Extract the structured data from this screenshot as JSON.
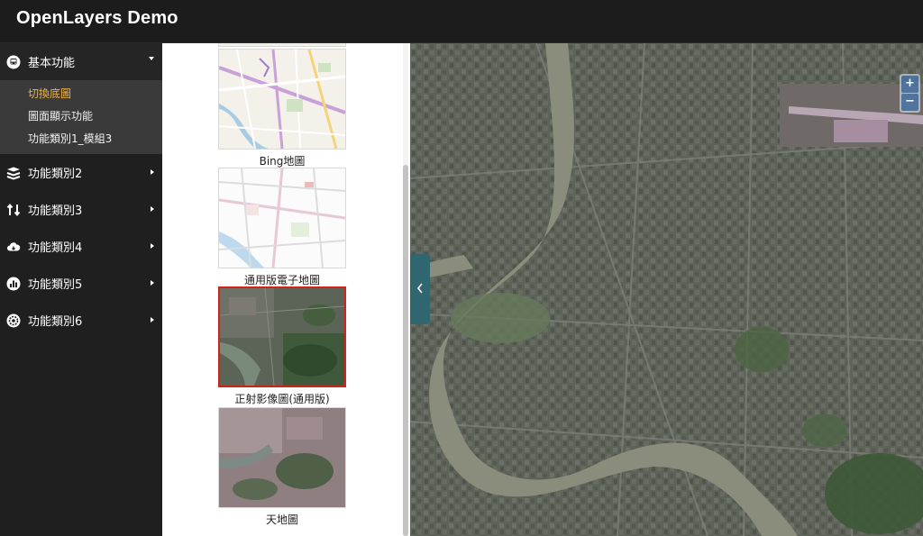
{
  "header": {
    "title": "OpenLayers Demo"
  },
  "sidebar": {
    "items": [
      {
        "label": "基本功能",
        "icon": "bus-icon",
        "expanded": true,
        "children": [
          {
            "label": "切換底圖",
            "active": true
          },
          {
            "label": "圖面顯示功能",
            "active": false
          },
          {
            "label": "功能類別1_模組3",
            "active": false
          }
        ]
      },
      {
        "label": "功能類別2",
        "icon": "layers-icon"
      },
      {
        "label": "功能類別3",
        "icon": "transfer-icon"
      },
      {
        "label": "功能類別4",
        "icon": "cloud-icon"
      },
      {
        "label": "功能類別5",
        "icon": "bar-chart-icon"
      },
      {
        "label": "功能類別6",
        "icon": "settings-icon"
      }
    ]
  },
  "basemaps": [
    {
      "caption": "Bing地圖",
      "selected": false
    },
    {
      "caption": "通用版電子地圖",
      "selected": false
    },
    {
      "caption": "正射影像圖(通用版)",
      "selected": true
    },
    {
      "caption": "天地圖",
      "selected": false
    }
  ],
  "map": {
    "zoom_in": "+",
    "zoom_out": "−"
  },
  "colors": {
    "accent": "#f2b33d",
    "selected_border": "#d0231c",
    "tab": "#2f6670"
  }
}
